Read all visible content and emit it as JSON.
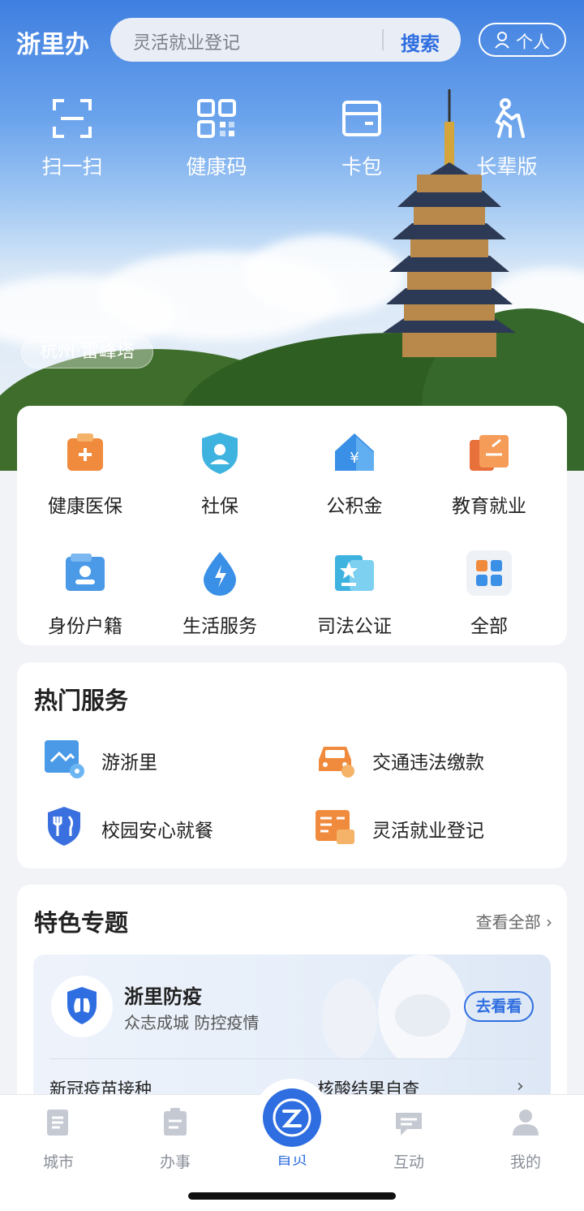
{
  "app": {
    "logo": "浙里办"
  },
  "search": {
    "placeholder": "灵活就业登记",
    "button": "搜索"
  },
  "profile": {
    "label": "个人"
  },
  "quick_actions": [
    {
      "label": "扫一扫",
      "icon": "scan-icon"
    },
    {
      "label": "健康码",
      "icon": "qrcode-icon"
    },
    {
      "label": "卡包",
      "icon": "card-wallet-icon"
    },
    {
      "label": "长辈版",
      "icon": "elder-icon"
    }
  ],
  "location": "杭州·雷峰塔",
  "services": [
    {
      "label": "健康医保",
      "icon": "medical-icon"
    },
    {
      "label": "社保",
      "icon": "social-security-icon"
    },
    {
      "label": "公积金",
      "icon": "housing-fund-icon"
    },
    {
      "label": "教育就业",
      "icon": "education-icon"
    },
    {
      "label": "身份户籍",
      "icon": "identity-icon"
    },
    {
      "label": "生活服务",
      "icon": "life-service-icon"
    },
    {
      "label": "司法公证",
      "icon": "justice-icon"
    },
    {
      "label": "全部",
      "icon": "all-apps-icon"
    }
  ],
  "hot": {
    "title": "热门服务",
    "items": [
      {
        "label": "游浙里",
        "icon": "travel-icon"
      },
      {
        "label": "交通违法缴款",
        "icon": "car-icon"
      },
      {
        "label": "校园安心就餐",
        "icon": "dining-icon"
      },
      {
        "label": "灵活就业登记",
        "icon": "register-icon"
      }
    ]
  },
  "featured": {
    "title": "特色专题",
    "more": "查看全部",
    "banner": {
      "title": "浙里防疫",
      "subtitle": "众志成城 防控疫情",
      "button": "去看看",
      "link1": "新冠疫苗接种",
      "link2": "核酸结果自查"
    }
  },
  "tabs": [
    {
      "label": "城市",
      "active": false
    },
    {
      "label": "办事",
      "active": false
    },
    {
      "label": "首页",
      "active": true
    },
    {
      "label": "互动",
      "active": false
    },
    {
      "label": "我的",
      "active": false
    }
  ],
  "colors": {
    "accent": "#2f6ee0",
    "orange": "#f08a3c",
    "teal": "#3fb3e0"
  }
}
